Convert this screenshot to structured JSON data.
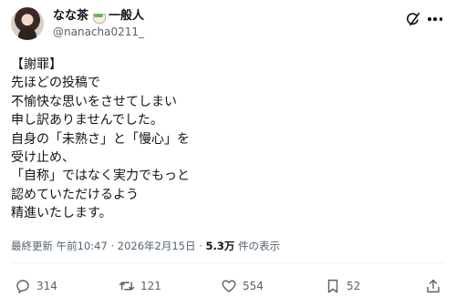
{
  "author": {
    "display_name": "なな茶",
    "display_name_suffix": "一般人",
    "emoji": "green-tea-icon",
    "handle": "@nanacha0211_"
  },
  "tweet": {
    "lines": [
      "【謝罪】",
      "先ほどの投稿で",
      "不愉快な思いをさせてしまい",
      "申し訳ありませんでした。",
      "自身の「未熟さ」と「慢心」を",
      "受け止め、",
      "「自称」ではなく実力でもっと",
      "認めていただけるよう",
      "精進いたします。"
    ]
  },
  "meta": {
    "edited_label": "最終更新",
    "time": "午前10:47",
    "separator": "·",
    "date": "2026年2月15日",
    "views_count": "5.3万",
    "views_label": "件の表示"
  },
  "actions": {
    "replies": "314",
    "reposts": "121",
    "likes": "554",
    "bookmarks": "52"
  },
  "icons": [
    "grok-icon",
    "more-icon",
    "reply-icon",
    "repost-icon",
    "like-icon",
    "bookmark-icon",
    "share-icon"
  ]
}
